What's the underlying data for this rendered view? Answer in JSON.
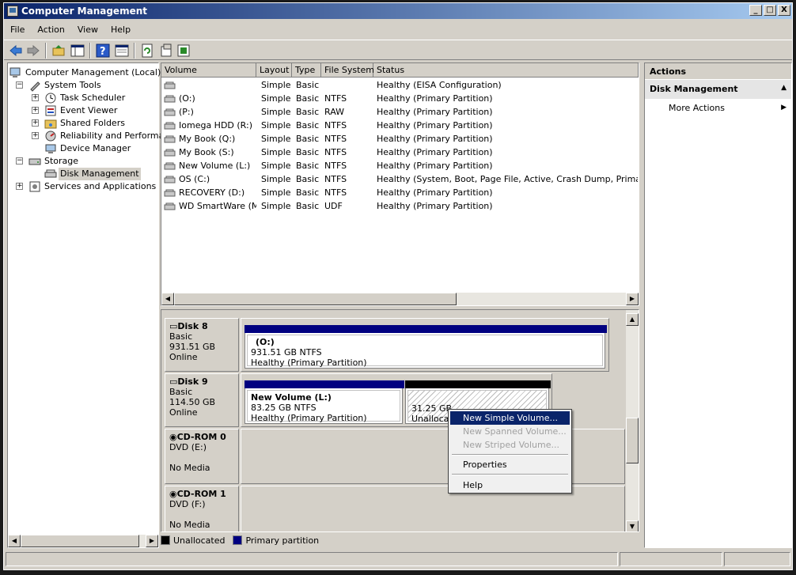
{
  "window": {
    "title": "Computer Management",
    "controls": [
      "_",
      "□",
      "X"
    ]
  },
  "menu": [
    "File",
    "Action",
    "View",
    "Help"
  ],
  "toolbar": {
    "icons": [
      "back-arrow-icon",
      "forward-arrow-icon",
      "up-folder-icon",
      "show-hide-console-tree-icon",
      "help-icon",
      "properties-view-icon",
      "refresh-icon",
      "export-list-icon",
      "console-properties-icon"
    ]
  },
  "tree": {
    "root": "Computer Management (Local)",
    "system_tools": "System Tools",
    "task_scheduler": "Task Scheduler",
    "event_viewer": "Event Viewer",
    "shared_folders": "Shared Folders",
    "reliability": "Reliability and Performanc",
    "device_manager": "Device Manager",
    "storage": "Storage",
    "disk_management": "Disk Management",
    "services": "Services and Applications",
    "expander_plus": "+",
    "expander_minus": "−"
  },
  "volumes": {
    "columns": [
      "Volume",
      "Layout",
      "Type",
      "File System",
      "Status"
    ],
    "rows": [
      {
        "volume": "",
        "layout": "Simple",
        "type": "Basic",
        "fs": "",
        "status": "Healthy (EISA Configuration)"
      },
      {
        "volume": "(O:)",
        "layout": "Simple",
        "type": "Basic",
        "fs": "NTFS",
        "status": "Healthy (Primary Partition)"
      },
      {
        "volume": "(P:)",
        "layout": "Simple",
        "type": "Basic",
        "fs": "RAW",
        "status": "Healthy (Primary Partition)"
      },
      {
        "volume": "Iomega HDD (R:)",
        "layout": "Simple",
        "type": "Basic",
        "fs": "NTFS",
        "status": "Healthy (Primary Partition)"
      },
      {
        "volume": "My Book (Q:)",
        "layout": "Simple",
        "type": "Basic",
        "fs": "NTFS",
        "status": "Healthy (Primary Partition)"
      },
      {
        "volume": "My Book (S:)",
        "layout": "Simple",
        "type": "Basic",
        "fs": "NTFS",
        "status": "Healthy (Primary Partition)"
      },
      {
        "volume": "New Volume (L:)",
        "layout": "Simple",
        "type": "Basic",
        "fs": "NTFS",
        "status": "Healthy (Primary Partition)"
      },
      {
        "volume": "OS (C:)",
        "layout": "Simple",
        "type": "Basic",
        "fs": "NTFS",
        "status": "Healthy (System, Boot, Page File, Active, Crash Dump, Primary Partition)"
      },
      {
        "volume": "RECOVERY (D:)",
        "layout": "Simple",
        "type": "Basic",
        "fs": "NTFS",
        "status": "Healthy (Primary Partition)"
      },
      {
        "volume": "WD SmartWare (M:)",
        "layout": "Simple",
        "type": "Basic",
        "fs": "UDF",
        "status": "Healthy (Primary Partition)"
      }
    ]
  },
  "disks": {
    "disk8": {
      "name": "Disk 8",
      "type": "Basic",
      "size": "931.51 GB",
      "state": "Online",
      "partition": {
        "label": "(O:)",
        "size": "931.51 GB NTFS",
        "status": "Healthy (Primary Partition)"
      }
    },
    "disk9": {
      "name": "Disk 9",
      "type": "Basic",
      "size": "114.50 GB",
      "state": "Online",
      "partition": {
        "label": "New Volume  (L:)",
        "size": "83.25 GB NTFS",
        "status": "Healthy (Primary Partition)"
      },
      "unallocated": {
        "size": "31.25 GB",
        "label": "Unallocated"
      }
    },
    "cdrom0": {
      "name": "CD-ROM 0",
      "drive": "DVD (E:)",
      "media": "No Media"
    },
    "cdrom1": {
      "name": "CD-ROM 1",
      "drive": "DVD (F:)",
      "media": "No Media"
    }
  },
  "legend": {
    "unallocated": "Unallocated",
    "primary": "Primary partition",
    "colors": {
      "unallocated": "#000000",
      "primary": "#000080"
    }
  },
  "actions": {
    "header": "Actions",
    "section": "Disk Management",
    "more": "More Actions"
  },
  "context_menu": {
    "new_simple": "New Simple Volume...",
    "new_spanned": "New Spanned Volume...",
    "new_striped": "New Striped Volume...",
    "properties": "Properties",
    "help": "Help"
  },
  "colors": {
    "title_start": "#0a246a",
    "title_end": "#a6caf0",
    "primary_bar": "#000080",
    "unallocated_bar": "#000000",
    "highlight": "#0a246a"
  }
}
